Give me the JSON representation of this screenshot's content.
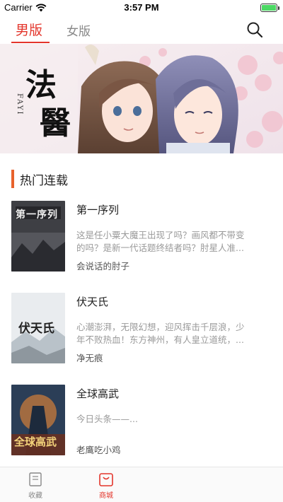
{
  "status_bar": {
    "carrier": "Carrier",
    "time": "3:57 PM",
    "battery_level": 1.0
  },
  "top_nav": {
    "tabs": [
      {
        "label": "男版",
        "active": true
      },
      {
        "label": "女版",
        "active": false
      }
    ],
    "search_icon": "search-icon"
  },
  "banner": {
    "title_chars": [
      "法",
      "醫"
    ],
    "subtitle": "FAYI"
  },
  "section": {
    "title": "热门连载"
  },
  "books": [
    {
      "title": "第一序列",
      "description": "这是任小粟大魔王出现了吗？画风都不带变的吗？是新一代话题终结者吗？肘星人准...",
      "author": "会说话的肘子",
      "cover_text": "第一序列"
    },
    {
      "title": "伏天氏",
      "description": "心潮澎湃，无限幻想，迎风挥击千层浪，少年不败热血！东方神州，有人皇立道统，...",
      "author": "净无痕",
      "cover_text": "伏天氏"
    },
    {
      "title": "全球高武",
      "description": "今日头条——...",
      "author": "老鹰吃小鸡",
      "cover_text": "全球高武"
    }
  ],
  "tabbar": {
    "items": [
      {
        "label": "收藏",
        "icon": "book-icon",
        "active": false
      },
      {
        "label": "商城",
        "icon": "shop-bag-icon",
        "active": true
      },
      {
        "label": "",
        "icon": "",
        "active": false
      },
      {
        "label": "",
        "icon": "",
        "active": false
      }
    ]
  },
  "colors": {
    "accent": "#e3352b",
    "section_bar": "#e8622c"
  }
}
